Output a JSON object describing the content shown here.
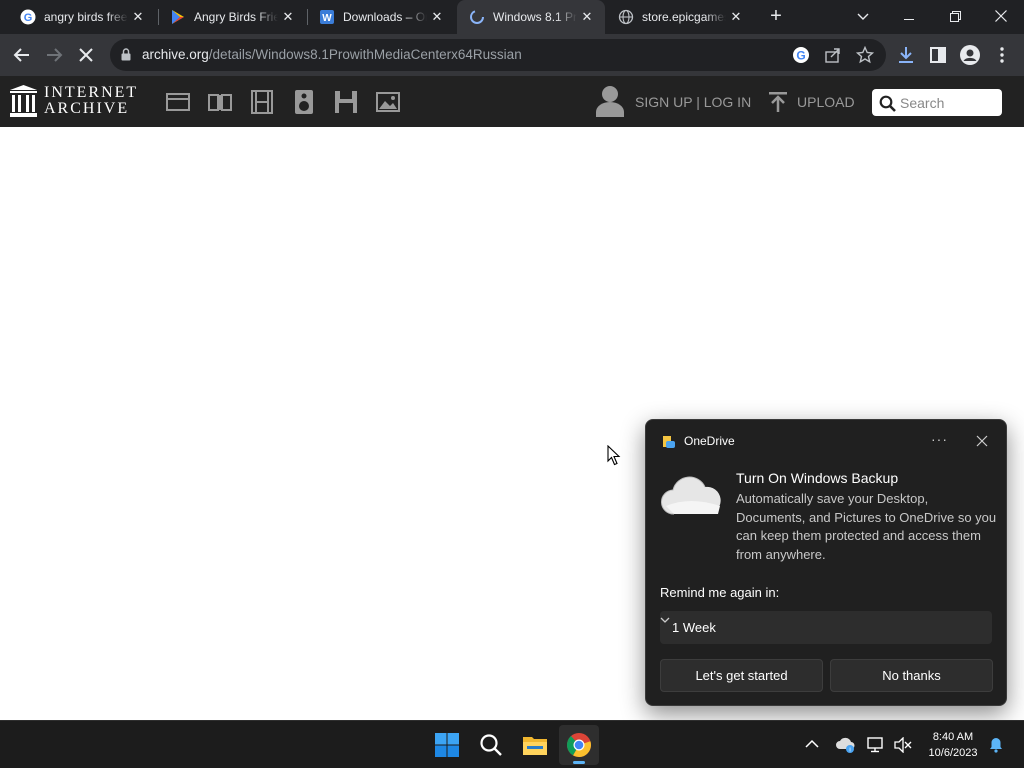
{
  "browser": {
    "tabs": [
      {
        "title": "angry birds free",
        "icon": "google-icon"
      },
      {
        "title": "Angry Birds Frie",
        "icon": "google-play-icon"
      },
      {
        "title": "Downloads – Or",
        "icon": "downloads-site-icon"
      },
      {
        "title": "Windows 8.1 Pr",
        "icon": "archive-loading-icon",
        "active": true
      },
      {
        "title": "store.epicgames",
        "icon": "globe-icon"
      }
    ],
    "url_host": "archive.org",
    "url_path": "/details/Windows8.1ProwithMediaCenterx64Russian"
  },
  "archive_header": {
    "logo_line1": "INTERNET",
    "logo_line2": "ARCHIVE",
    "nav_icons": [
      "web-icon",
      "texts-icon",
      "video-icon",
      "audio-icon",
      "software-icon",
      "images-icon"
    ],
    "signup_login": "SIGN UP | LOG IN",
    "upload": "UPLOAD",
    "search_placeholder": "Search"
  },
  "toast": {
    "app_name": "OneDrive",
    "headline": "Turn On Windows Backup",
    "body": "Automatically save your Desktop, Documents, and Pictures to OneDrive so you can keep them protected and access them from anywhere.",
    "remind_label": "Remind me again in:",
    "remind_value": "1 Week",
    "primary_button": "Let's get started",
    "secondary_button": "No thanks"
  },
  "taskbar": {
    "time": "8:40 AM",
    "date": "10/6/2023"
  }
}
